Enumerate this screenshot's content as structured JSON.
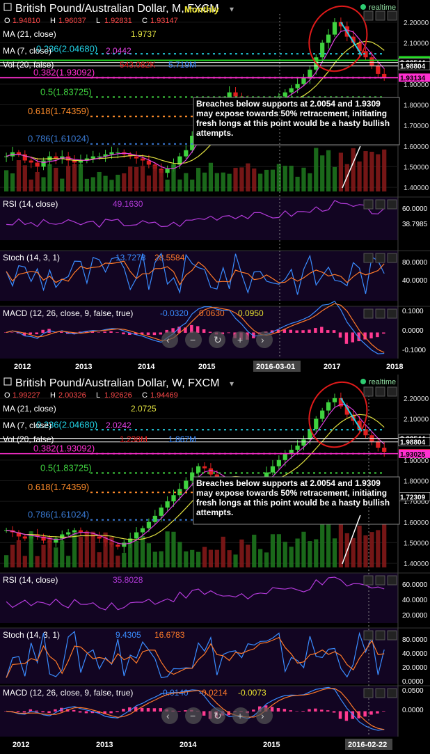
{
  "colors": {
    "bg": "#000000",
    "pane": "#0d0418",
    "up": "#3fd23f",
    "down": "#e02020",
    "ma21": "#e0e040",
    "ma7": "#e040e0",
    "fib": "#3a7bd5",
    "cyan": "#22d3e6",
    "green_line": "#22dd22",
    "magenta_line": "#ff2fd0",
    "white_line": "#ffffff",
    "stoch_k": "#3a8cff",
    "stoch_d": "#ff7a2a",
    "rsi": "#b23ad9",
    "macd_line": "#3a8cff",
    "signal": "#ff7a2a",
    "hist": "#ff3a90",
    "red_circle": "#e01a1a"
  },
  "charts": [
    {
      "id": "monthly",
      "title": "British Pound/Australian Dollar, M, FXCM",
      "watermark": "Monthly",
      "realtime": "realtime",
      "ohlc": [
        [
          "O",
          "1.94810"
        ],
        [
          "H",
          "1.96037"
        ],
        [
          "L",
          "1.92831"
        ],
        [
          "C",
          "1.93147"
        ]
      ],
      "ma21_label": "MA (21, close)",
      "ma21_value": "1.9737",
      "ma7_label": "MA (7, close)",
      "ma7_value": "2.0442",
      "vol_label": "Vol (20, false)",
      "vol_values": [
        "543.082K",
        "5.719M"
      ],
      "rsi_label": "RSI (14, close)",
      "rsi_value": "49.1630",
      "stoch_label": "Stoch (14, 3, 1)",
      "stoch_values": [
        "13.7278",
        "28.5584"
      ],
      "macd_label": "MACD (12, 26, close, 9, false, true)",
      "macd_values": [
        "-0.0320",
        "0.0630",
        "0.0950"
      ],
      "fibs": [
        {
          "label": "0.236(2.04680)",
          "price": 2.0468,
          "color": "#22d3e6"
        },
        {
          "label": "0.382(1.93092)",
          "price": 1.93092,
          "color": "#ff2fd0"
        },
        {
          "label": "0.5(1.83725)",
          "price": 1.83725,
          "color": "#3fd23f"
        },
        {
          "label": "0.618(1.74359)",
          "price": 1.74359,
          "color": "#ff8c2a"
        },
        {
          "label": "0.786(1.61024)",
          "price": 1.61024,
          "color": "#3a7bd5"
        }
      ],
      "price_ticks": [
        "2.20000",
        "2.10000",
        "2.00000",
        "1.90000",
        "1.80000",
        "1.70000",
        "1.60000",
        "1.50000",
        "1.40000"
      ],
      "price_badges": [
        {
          "text": "2.01522",
          "color": "#22dd22",
          "price": 2.01522
        },
        {
          "text": "2.00544",
          "color": "#ffffff",
          "price": 2.00544
        },
        {
          "text": "1.98804",
          "color": "#ffffff",
          "price": 1.98804
        },
        {
          "text": "1.93147",
          "color": "#e02020",
          "price": 1.93147
        },
        {
          "text": "1.93134",
          "color": "#ff2fd0",
          "price": 1.93134
        }
      ],
      "rsi_ticks": [
        "60.0000",
        "38.7985"
      ],
      "stoch_ticks": [
        "80.0000",
        "40.0000"
      ],
      "macd_ticks": [
        "0.1000",
        "0.0000",
        "-0.1000"
      ],
      "x_ticks": [
        "2012",
        "2013",
        "2014",
        "2015",
        "2016-03-01",
        "2017",
        "2018"
      ],
      "annotation": "Breaches below supports at 2.0054 and 1.9309 may expose towards 50% retracement, initiating fresh longs at this point would be a hasty bullish attempts."
    },
    {
      "id": "weekly",
      "title": "British Pound/Australian Dollar, W, FXCM",
      "realtime": "realtime",
      "ohlc": [
        [
          "O",
          "1.99227"
        ],
        [
          "H",
          "2.00326"
        ],
        [
          "L",
          "1.92626"
        ],
        [
          "C",
          "1.94469"
        ]
      ],
      "ma21_label": "MA (21, close)",
      "ma21_value": "2.0725",
      "ma7_label": "MA (7, close)",
      "ma7_value": "2.0242",
      "vol_label": "Vol (20, false)",
      "vol_values": [
        "1.238M",
        "1.867M"
      ],
      "rsi_label": "RSI (14, close)",
      "rsi_value": "35.8028",
      "stoch_label": "Stoch (14, 3, 1)",
      "stoch_values": [
        "9.4305",
        "16.6783"
      ],
      "macd_label": "MACD (12, 26, close, 9, false, true)",
      "macd_values": [
        "-0.0140",
        "-0.0214",
        "-0.0073"
      ],
      "fibs": [
        {
          "label": "0.236(2.04680)",
          "price": 2.0468,
          "color": "#22d3e6"
        },
        {
          "label": "0.382(1.93092)",
          "price": 1.93092,
          "color": "#ff2fd0"
        },
        {
          "label": "0.5(1.83725)",
          "price": 1.83725,
          "color": "#3fd23f"
        },
        {
          "label": "0.618(1.74359)",
          "price": 1.74359,
          "color": "#ff8c2a"
        },
        {
          "label": "0.786(1.61024)",
          "price": 1.61024,
          "color": "#3a7bd5"
        }
      ],
      "price_ticks": [
        "2.20000",
        "2.10000",
        "2.00000",
        "1.90000",
        "1.80000",
        "1.70000",
        "1.60000",
        "1.50000",
        "1.40000"
      ],
      "price_badges": [
        {
          "text": "2.00544",
          "color": "#ffffff",
          "price": 2.00544
        },
        {
          "text": "1.98804",
          "color": "#ffffff",
          "price": 1.98804
        },
        {
          "text": "1.93291",
          "color": "#e02020",
          "price": 1.93291
        },
        {
          "text": "1.93025",
          "color": "#ff2fd0",
          "price": 1.93025
        },
        {
          "text": "1.72309",
          "color": "#ffffff",
          "price": 1.72309
        }
      ],
      "rsi_ticks": [
        "60.0000",
        "40.0000",
        "20.0000"
      ],
      "stoch_ticks": [
        "80.0000",
        "40.0000",
        "20.0000",
        "0.0000"
      ],
      "macd_ticks": [
        "0.0500",
        "0.0000"
      ],
      "x_ticks": [
        "2012",
        "2013",
        "2014",
        "2015",
        "2016-02-22"
      ],
      "annotation": "Breaches below supports at 2.0054 and 1.9309 may expose towards 50% retracement, initiating fresh longs at this point would be a hasty bullish attempts."
    }
  ],
  "chart_data": [
    {
      "type": "candlestick",
      "title": "British Pound/Australian Dollar, M, FXCM",
      "ylim": [
        1.38,
        2.24
      ],
      "close_series": [
        1.55,
        1.57,
        1.56,
        1.53,
        1.52,
        1.5,
        1.53,
        1.55,
        1.54,
        1.55,
        1.53,
        1.52,
        1.53,
        1.54,
        1.55,
        1.55,
        1.56,
        1.57,
        1.57,
        1.56,
        1.55,
        1.54,
        1.53,
        1.51,
        1.49,
        1.47,
        1.49,
        1.51,
        1.55,
        1.58,
        1.65,
        1.7,
        1.74,
        1.77,
        1.79,
        1.82,
        1.86,
        1.84,
        1.83,
        1.8,
        1.78,
        1.79,
        1.8,
        1.82,
        1.84,
        1.86,
        1.88,
        1.9,
        1.93,
        1.97,
        2.03,
        2.1,
        2.14,
        2.2,
        2.18,
        2.13,
        2.1,
        2.06,
        2.03,
        1.99,
        1.95,
        1.93
      ],
      "annotations": [
        "Breaches below supports at 2.0054 and 1.9309 may expose towards 50% retracement, initiating fresh longs at this point would be a hasty bullish attempts."
      ]
    },
    {
      "type": "candlestick",
      "title": "British Pound/Australian Dollar, W, FXCM",
      "ylim": [
        1.38,
        2.24
      ],
      "close_series": [
        1.56,
        1.55,
        1.53,
        1.52,
        1.54,
        1.53,
        1.51,
        1.5,
        1.52,
        1.54,
        1.55,
        1.56,
        1.55,
        1.54,
        1.53,
        1.52,
        1.5,
        1.49,
        1.48,
        1.5,
        1.52,
        1.55,
        1.57,
        1.6,
        1.63,
        1.67,
        1.7,
        1.73,
        1.76,
        1.8,
        1.84,
        1.87,
        1.86,
        1.83,
        1.81,
        1.8,
        1.78,
        1.79,
        1.78,
        1.76,
        1.77,
        1.8,
        1.84,
        1.87,
        1.9,
        1.93,
        1.95,
        1.97,
        2.0,
        2.05,
        2.1,
        2.14,
        2.18,
        2.2,
        2.16,
        2.12,
        2.09,
        2.05,
        2.02,
        1.99,
        1.96,
        1.94
      ],
      "annotations": [
        "Breaches below supports at 2.0054 and 1.9309 may expose towards 50% retracement, initiating fresh longs at this point would be a hasty bullish attempts."
      ]
    }
  ]
}
